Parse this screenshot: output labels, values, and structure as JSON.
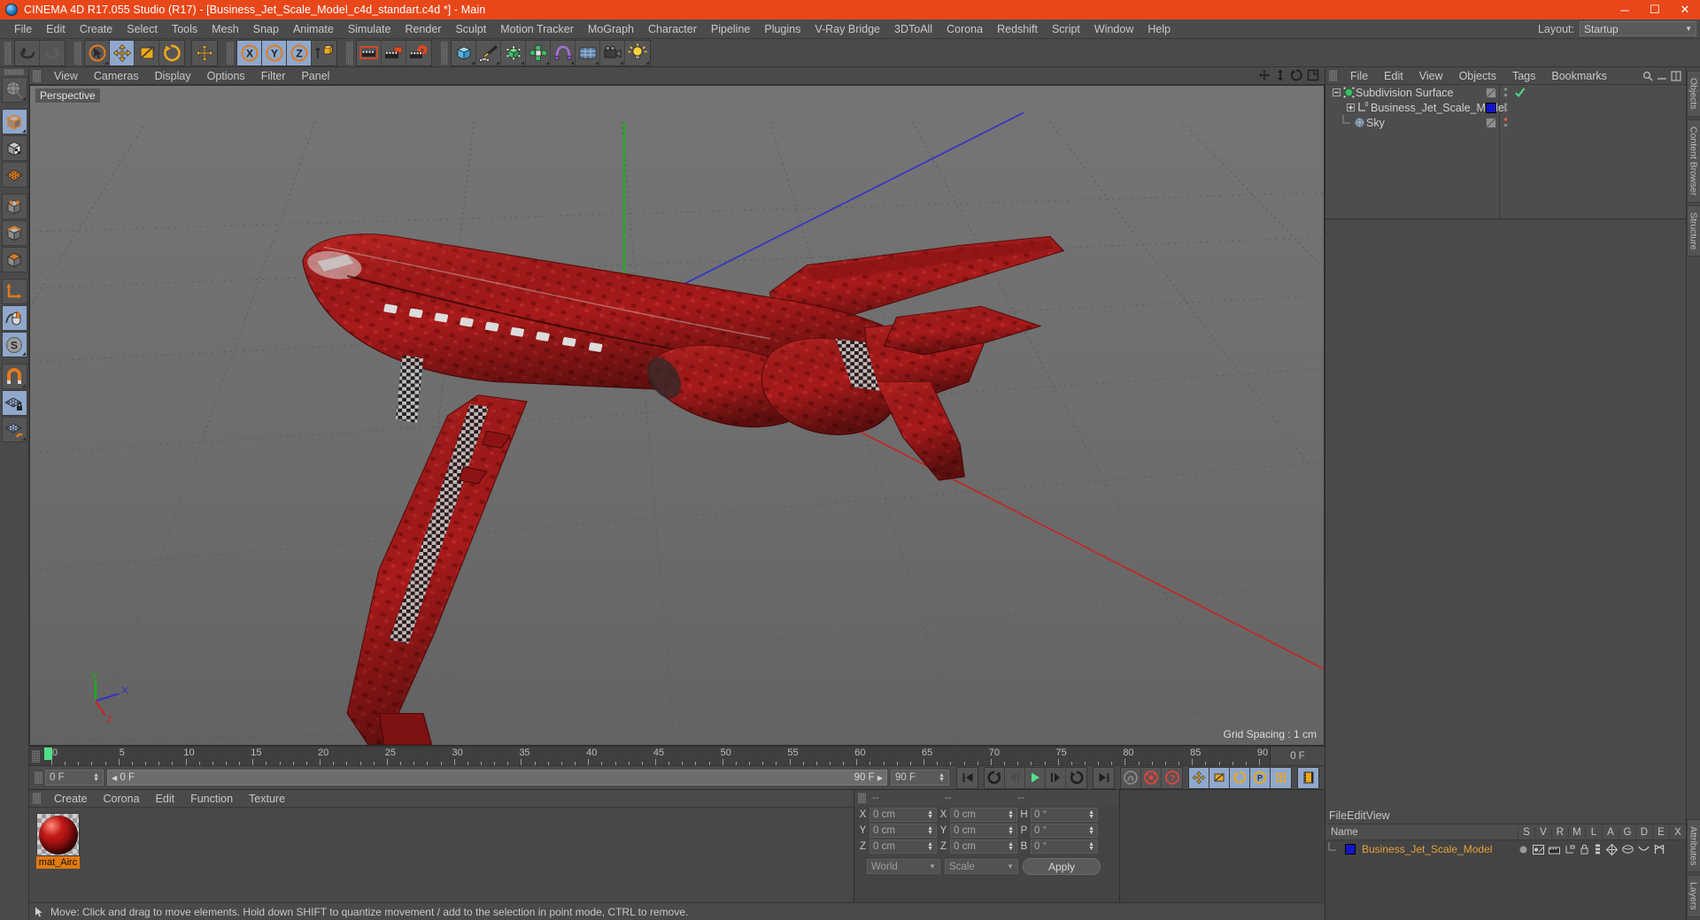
{
  "window": {
    "title": "CINEMA 4D R17.055 Studio (R17) - [Business_Jet_Scale_Model_c4d_standart.c4d *] - Main",
    "app_icon": "cinema4d-logo-icon",
    "minimize": "─",
    "maximize": "☐",
    "close": "✕",
    "titlebar_color": "#e8471a"
  },
  "menubar": {
    "items": [
      "File",
      "Edit",
      "Create",
      "Select",
      "Tools",
      "Mesh",
      "Snap",
      "Animate",
      "Simulate",
      "Render",
      "Sculpt",
      "Motion Tracker",
      "MoGraph",
      "Character",
      "Pipeline",
      "Plugins",
      "V-Ray Bridge",
      "3DToAll",
      "Corona",
      "Redshift",
      "Script",
      "Window",
      "Help"
    ],
    "layout_label": "Layout:",
    "layout_value": "Startup"
  },
  "toolbar": {
    "groups": [
      {
        "name": "undo-redo",
        "buttons": [
          {
            "name": "undo-button",
            "icon": "undo-arrow-icon",
            "state": "normal"
          },
          {
            "name": "redo-button",
            "icon": "redo-arrow-icon",
            "state": "disabled"
          }
        ]
      },
      {
        "name": "transform-tools",
        "buttons": [
          {
            "name": "live-selection-tool",
            "icon": "cursor-circle-icon",
            "state": "normal"
          },
          {
            "name": "move-tool",
            "icon": "move-arrows-icon",
            "state": "active"
          },
          {
            "name": "scale-tool",
            "icon": "scale-box-icon",
            "state": "normal"
          },
          {
            "name": "rotate-tool",
            "icon": "rotate-circle-icon",
            "state": "normal"
          }
        ]
      },
      {
        "name": "move-group",
        "buttons": [
          {
            "name": "move-duplicate-tool",
            "icon": "move-arrows-icon",
            "state": "normal"
          }
        ]
      },
      {
        "name": "axis-locks",
        "buttons": [
          {
            "name": "lock-x-axis",
            "icon": "x-axis-icon",
            "label": "X",
            "state": "active"
          },
          {
            "name": "lock-y-axis",
            "icon": "y-axis-icon",
            "label": "Y",
            "state": "active"
          },
          {
            "name": "lock-z-axis",
            "icon": "z-axis-icon",
            "label": "Z",
            "state": "active"
          },
          {
            "name": "world-object-coordinates",
            "icon": "world-cube-icon",
            "state": "normal"
          }
        ]
      },
      {
        "name": "render-group",
        "buttons": [
          {
            "name": "render-view-button",
            "icon": "clapper-board-icon",
            "state": "normal"
          },
          {
            "name": "render-to-picture-viewer",
            "icon": "clapper-picture-icon",
            "state": "normal"
          },
          {
            "name": "render-settings-button",
            "icon": "clapper-gear-icon",
            "state": "normal"
          }
        ]
      },
      {
        "name": "primitives-group",
        "buttons": [
          {
            "name": "add-cube-primitive",
            "icon": "blue-cube-icon",
            "state": "normal"
          },
          {
            "name": "add-spline-pen",
            "icon": "pen-nib-icon",
            "state": "normal"
          },
          {
            "name": "add-nurbs-generator",
            "icon": "green-cube-points-icon",
            "state": "normal"
          },
          {
            "name": "add-array-object",
            "icon": "green-array-icon",
            "state": "normal"
          },
          {
            "name": "add-bend-deformer",
            "icon": "purple-deformer-icon",
            "state": "normal"
          },
          {
            "name": "add-environment-object",
            "icon": "environment-grid-icon",
            "state": "normal"
          },
          {
            "name": "add-camera-object",
            "icon": "camera-icon",
            "state": "normal"
          },
          {
            "name": "add-light-object",
            "icon": "light-bulb-icon",
            "state": "normal"
          }
        ]
      }
    ]
  },
  "left_palette": {
    "items": [
      {
        "name": "viewport-navigation-tool",
        "icon": "globe-sphere-icon",
        "state": "normal"
      },
      {
        "name": "model-mode-button",
        "icon": "model-cube-icon",
        "state": "active"
      },
      {
        "name": "texture-mode-button",
        "icon": "texture-checker-cube-icon",
        "state": "normal"
      },
      {
        "name": "workplane-mode-button",
        "icon": "workplane-grid-icon",
        "state": "normal"
      },
      {
        "name": "points-mode-button",
        "icon": "points-cube-icon",
        "state": "normal"
      },
      {
        "name": "edges-mode-button",
        "icon": "edges-cube-icon",
        "state": "normal"
      },
      {
        "name": "polygons-mode-button",
        "icon": "polygons-cube-icon",
        "state": "normal"
      },
      {
        "name": "object-axis-tool",
        "icon": "axis-corner-icon",
        "state": "normal"
      },
      {
        "name": "enable-axis-modification",
        "icon": "mouse-cursor-icon",
        "state": "active"
      },
      {
        "name": "soft-selection-button",
        "icon": "s-compass-icon",
        "state": "active"
      },
      {
        "name": "enable-snapping-button",
        "icon": "magnet-icon",
        "state": "normal"
      },
      {
        "name": "lock-workplane-button",
        "icon": "grid-lock-icon",
        "state": "active"
      },
      {
        "name": "workplane-tools-button",
        "icon": "grid-wrench-icon",
        "state": "normal"
      }
    ]
  },
  "viewport": {
    "menu": [
      "View",
      "Cameras",
      "Display",
      "Options",
      "Filter",
      "Panel"
    ],
    "label": "Perspective",
    "grid_spacing": "Grid Spacing : 1 cm",
    "axis_labels": {
      "y": "Y",
      "x": "X",
      "z": "Z"
    },
    "corner_icons": [
      {
        "name": "viewport-move-icon",
        "icon": "move-arrows-icon"
      },
      {
        "name": "viewport-scale-icon",
        "icon": "vertical-arrows-icon"
      },
      {
        "name": "viewport-rotate-icon",
        "icon": "rotate-icon"
      },
      {
        "name": "viewport-maximize-icon",
        "icon": "maximize-panel-icon"
      }
    ],
    "scene": {
      "model_color": "#b01d1d",
      "background_color": "#6e6e6e",
      "grid_color": "#5a5a5a",
      "y_axis_color": "#21c321",
      "z_axis_color": "#3c3cd7",
      "x_axis_color": "#d03030"
    }
  },
  "timeline": {
    "ticks": [
      0,
      5,
      10,
      15,
      20,
      25,
      30,
      35,
      40,
      45,
      50,
      55,
      60,
      65,
      70,
      75,
      80,
      85,
      90
    ],
    "range_start": 0,
    "range_end": 90,
    "current_frame_marker": 0,
    "end_field": "0 F",
    "frame_field": "0 F",
    "scrub_left": "0 F",
    "scrub_right": "90 F",
    "end_field_2": "90 F",
    "transport": [
      {
        "name": "go-to-start-button",
        "icon": "skip-start-icon",
        "state": "normal"
      },
      {
        "name": "go-to-previous-key-button",
        "icon": "prev-key-icon",
        "state": "normal"
      },
      {
        "name": "step-back-button",
        "icon": "step-back-icon",
        "state": "normal"
      },
      {
        "name": "play-button",
        "icon": "play-triangle-icon",
        "state": "normal"
      },
      {
        "name": "step-forward-button",
        "icon": "step-forward-icon",
        "state": "normal"
      },
      {
        "name": "go-to-next-key-button",
        "icon": "next-key-icon",
        "state": "normal"
      },
      {
        "name": "go-to-end-button",
        "icon": "skip-end-icon",
        "state": "normal"
      },
      {
        "name": "record-active-objects-button",
        "icon": "record-ghost-icon",
        "state": "disabled"
      },
      {
        "name": "autokeying-button",
        "icon": "autokey-red-icon",
        "state": "normal"
      },
      {
        "name": "keyframe-selection-button",
        "icon": "question-red-icon",
        "state": "normal"
      },
      {
        "name": "position-key-button",
        "icon": "move-arrows-icon",
        "state": "active"
      },
      {
        "name": "scale-key-button",
        "icon": "scale-box-icon",
        "state": "active"
      },
      {
        "name": "rotation-key-button",
        "icon": "rotate-circle-icon",
        "state": "active"
      },
      {
        "name": "parameter-key-button",
        "icon": "p-circle-icon",
        "state": "active"
      },
      {
        "name": "point-level-animation-button",
        "icon": "pla-dots-icon",
        "state": "active"
      },
      {
        "name": "timeline-toggle-button",
        "icon": "film-strip-icon",
        "state": "active"
      }
    ]
  },
  "material_manager": {
    "menu": [
      "Create",
      "Corona",
      "Edit",
      "Function",
      "Texture"
    ],
    "materials": [
      {
        "name": "mat_Aircraft",
        "label": "mat_Airc",
        "color": "#b01616"
      }
    ]
  },
  "coordinate_manager": {
    "headers": [
      "--",
      "--",
      "--"
    ],
    "rows": [
      {
        "axis1": "X",
        "value1": "0 cm",
        "axis2": "X",
        "value2": "0 cm",
        "axis3": "H",
        "value3": "0 °"
      },
      {
        "axis1": "Y",
        "value1": "0 cm",
        "axis2": "Y",
        "value2": "0 cm",
        "axis3": "P",
        "value3": "0 °"
      },
      {
        "axis1": "Z",
        "value1": "0 cm",
        "axis2": "Z",
        "value2": "0 cm",
        "axis3": "B",
        "value3": "0 °"
      }
    ],
    "space_select": "World",
    "mode_select": "Scale",
    "apply_button": "Apply"
  },
  "object_manager": {
    "menu": [
      "File",
      "Edit",
      "View",
      "Objects",
      "Tags",
      "Bookmarks"
    ],
    "rows": [
      {
        "name": "Subdivision Surface",
        "icon": "subdivision-surface-icon",
        "expanded": true,
        "indent": 0,
        "tag_swatch": "checker",
        "check": "✓",
        "selected": false
      },
      {
        "name": "Business_Jet_Scale_Model",
        "icon": "null-object-icon",
        "expanded": false,
        "indent": 1,
        "tag_swatch": "#1414c8",
        "check": "",
        "selected": false
      },
      {
        "name": "Sky",
        "icon": "sky-object-icon",
        "expanded": false,
        "indent": 0,
        "tag_swatch": "checker",
        "check": "",
        "dot": "#e05a4a",
        "selected": false
      }
    ]
  },
  "layer_manager": {
    "menu": [
      "File",
      "Edit",
      "View"
    ],
    "columns": [
      "Name",
      "S",
      "V",
      "R",
      "M",
      "L",
      "A",
      "G",
      "D",
      "E",
      "X"
    ],
    "rows": [
      {
        "name": "Business_Jet_Scale_Model",
        "swatch": "#1414c8",
        "icons": [
          "solo-dot-icon",
          "view-icon",
          "render-icon",
          "manager-icon",
          "lock-icon",
          "animation-icon",
          "generator-icon",
          "deformer-icon",
          "expression-icon",
          "xpresso-icon"
        ]
      }
    ]
  },
  "right_tabs": [
    "Objects",
    "Content Browser",
    "Structure",
    "Attributes",
    "Layers"
  ],
  "statusbar": {
    "icon": "info-arrow-icon",
    "text": "Move: Click and drag to move elements. Hold down SHIFT to quantize movement / add to the selection in point mode, CTRL to remove."
  }
}
